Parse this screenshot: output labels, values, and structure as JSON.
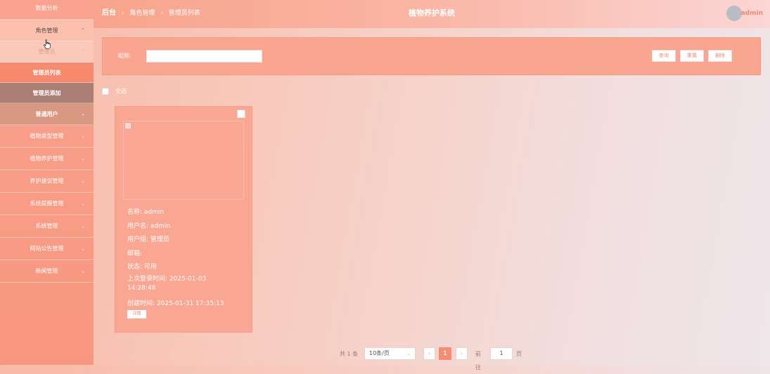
{
  "sidebar": {
    "items": [
      {
        "label": "数据分析",
        "chevron": false
      },
      {
        "label": "角色管理",
        "chevron": true,
        "chevron_glyph": "⌃"
      },
      {
        "label": "管理员",
        "chevron": true,
        "chevron_glyph": "⌃"
      },
      {
        "label": "管理员列表",
        "chevron": false
      },
      {
        "label": "管理员添加",
        "chevron": false
      },
      {
        "label": "普通用户",
        "chevron": true,
        "chevron_glyph": "⌄"
      },
      {
        "label": "植物类型管理",
        "chevron": true,
        "chevron_glyph": "⌄"
      },
      {
        "label": "植物养护管理",
        "chevron": true,
        "chevron_glyph": "⌄"
      },
      {
        "label": "养护建议管理",
        "chevron": true,
        "chevron_glyph": "⌄"
      },
      {
        "label": "系统提醒管理",
        "chevron": true,
        "chevron_glyph": "⌄"
      },
      {
        "label": "系统管理",
        "chevron": true,
        "chevron_glyph": "⌄"
      },
      {
        "label": "网站公告管理",
        "chevron": true,
        "chevron_glyph": "⌄"
      },
      {
        "label": "新闻管理",
        "chevron": true,
        "chevron_glyph": "⌄"
      }
    ]
  },
  "header": {
    "breadcrumb": [
      "后台",
      "角色管理",
      "管理员列表"
    ],
    "breadcrumb_sep": "›",
    "system_title": "植物养护系统",
    "user_name": "admin"
  },
  "search": {
    "label": "昵称:",
    "value": "",
    "placeholder": "",
    "query_btn": "查询",
    "reset_btn": "重置",
    "delete_btn": "删除"
  },
  "select_all": {
    "label": "全选"
  },
  "card": {
    "name": "名称: admin",
    "username": "用户名: admin",
    "group": "用户组: 管理员",
    "email": "邮箱:",
    "status": "状态: 可用",
    "last_login": "上次登录时间: 2025-01-03 14:28:48",
    "created": "创建时间: 2025-01-31 17:35:13",
    "detail_btn": "详情"
  },
  "pagination": {
    "total": "共 1 条",
    "page_size": "10条/页",
    "prev": "‹",
    "next": "›",
    "current_page": "1",
    "goto_label": "前往",
    "goto_value": "1",
    "page_unit": "页"
  },
  "colors": {
    "accent": "#f68d72",
    "sidebar_bg": "#f8977f",
    "active_item": "#f78a6c"
  }
}
